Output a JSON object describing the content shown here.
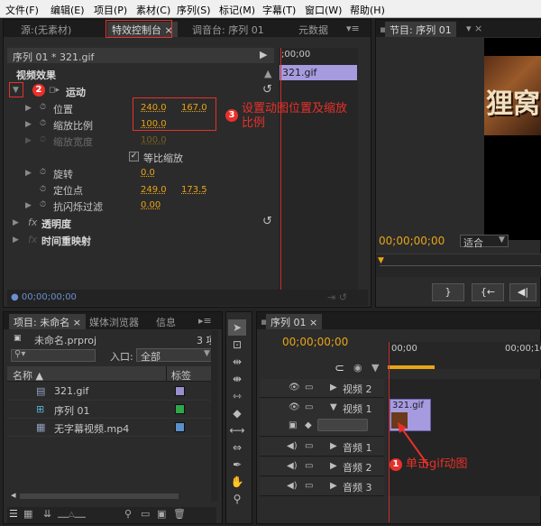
{
  "menu": [
    "文件(F)",
    "编辑(E)",
    "项目(P)",
    "素材(C)",
    "序列(S)",
    "标记(M)",
    "字幕(T)",
    "窗口(W)",
    "帮助(H)"
  ],
  "source_tabs": [
    "源:(无素材)",
    "特效控制台",
    "调音台: 序列 01",
    "元数据"
  ],
  "effect": {
    "header_sequence": "序列 01 * 321.gif",
    "clip_label": "321.gif",
    "ruler_label": ";00;00",
    "section_title": "视频效果",
    "motion_label": "运动",
    "props": [
      {
        "label": "位置",
        "v1": "240.0",
        "v2": "167.0"
      },
      {
        "label": "缩放比例",
        "v1": "100.0"
      },
      {
        "label": "缩放宽度",
        "v1": "100.0"
      },
      {
        "label": "等比缩放"
      },
      {
        "label": "旋转",
        "v1": "0.0"
      },
      {
        "label": "定位点",
        "v1": "249.0",
        "v2": "173.5"
      },
      {
        "label": "抗闪烁过滤",
        "v1": "0.00"
      }
    ],
    "opacity_label": "透明度",
    "time_remap_label": "时间重映射",
    "timecode": "00;00;00;00"
  },
  "program": {
    "tab": "节目: 序列 01",
    "preview_text": "狸窝",
    "timecode": "00;00;00;00",
    "fit_option": "适合"
  },
  "project": {
    "tabs": [
      "项目: 未命名",
      "媒体浏览器",
      "信息"
    ],
    "filename": "未命名.prproj",
    "count": "3 项",
    "search_placeholder": "",
    "entry_label": "入口:",
    "entry_value": "全部",
    "col_name": "名称",
    "col_label": "标签",
    "items": [
      {
        "name": "321.gif",
        "color": "#9b8ecf"
      },
      {
        "name": "序列 01",
        "color": "#2ea84a"
      },
      {
        "name": "无字幕视频.mp4",
        "color": "#5b8fc9"
      }
    ]
  },
  "timeline": {
    "tab": "序列 01",
    "timecode": "00;00;00;00",
    "ruler_labels": [
      "00;00",
      "00;00;16"
    ],
    "tracks": [
      {
        "name": "视频 2",
        "type": "video"
      },
      {
        "name": "视频 1",
        "type": "video"
      },
      {
        "name": "音频 1",
        "type": "audio"
      },
      {
        "name": "音频 2",
        "type": "audio"
      },
      {
        "name": "音频 3",
        "type": "audio"
      }
    ],
    "clip_label": "321.gif"
  },
  "annotations": {
    "n1": "1",
    "n2": "2",
    "n3": "3",
    "text3": "设置动图位置及缩放比例",
    "text1": "单击gif动图"
  },
  "colors": {
    "accent_orange": "#e8a417",
    "annotation_red": "#e8302a",
    "clip_purple": "#a79be0"
  }
}
